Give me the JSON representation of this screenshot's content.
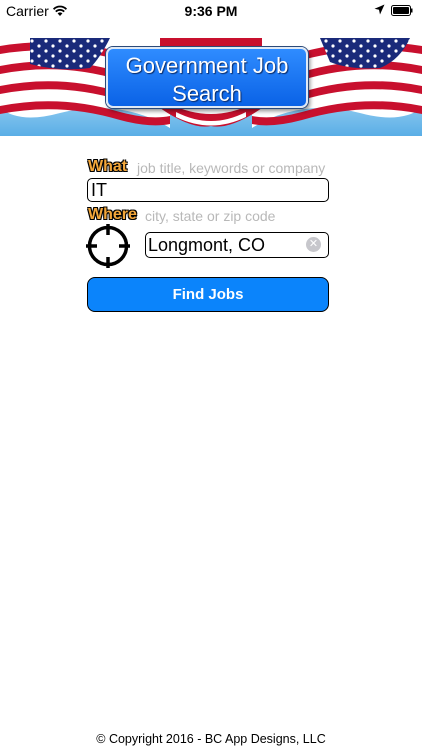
{
  "status_bar": {
    "carrier": "Carrier",
    "time": "9:36 PM",
    "icons": [
      "wifi-icon",
      "location-arrow-icon",
      "battery-icon"
    ]
  },
  "banner": {
    "title_line1": "Government Job",
    "title_line2": "Search",
    "colors": {
      "flag_red": "#c8102e",
      "flag_blue": "#1a2a7a",
      "title_blue": "#0a62e6"
    }
  },
  "search": {
    "what_label": "What",
    "what_hint": "job title, keywords or company",
    "what_value": "IT",
    "where_label": "Where",
    "where_hint": "city, state or zip code",
    "where_value": "Longmont, CO",
    "find_button": "Find Jobs"
  },
  "footer": {
    "copyright": "© Copyright 2016 - BC App Designs, LLC"
  }
}
